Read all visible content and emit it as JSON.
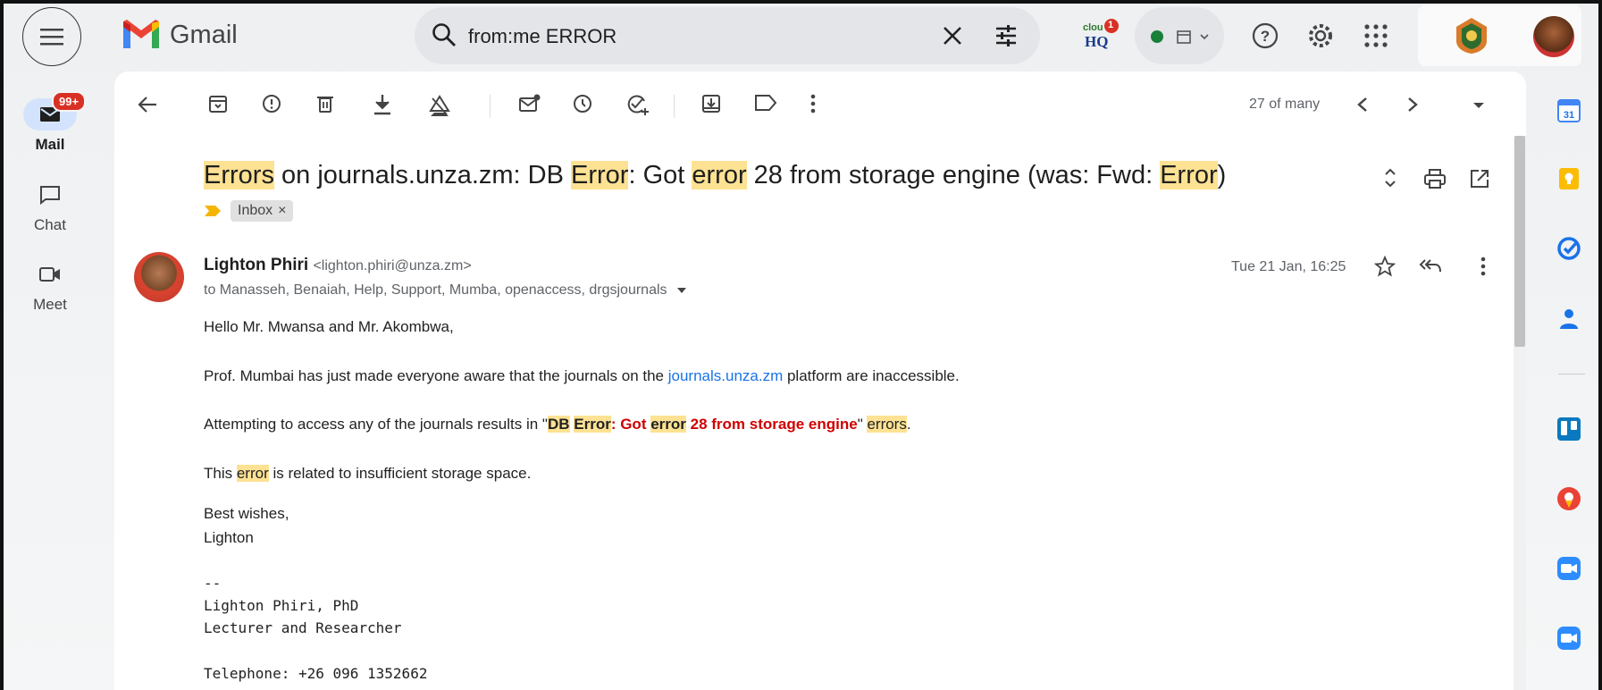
{
  "app": {
    "name": "Gmail"
  },
  "search": {
    "query": "from:me ERROR"
  },
  "topbar": {
    "clouhq_badge": "1"
  },
  "nav": {
    "mail_label": "Mail",
    "mail_badge": "99+",
    "chat_label": "Chat",
    "meet_label": "Meet"
  },
  "toolbar": {
    "pager": "27 of many"
  },
  "email": {
    "subject_parts": [
      "Errors",
      " on journals.unza.zm: DB ",
      "Error",
      ": Got ",
      "error",
      " 28 from storage engine (was: Fwd: ",
      "Error",
      ")"
    ],
    "labels": [
      "Inbox"
    ],
    "sender_name": "Lighton Phiri",
    "sender_email": "<lighton.phiri@unza.zm>",
    "recipients": "to Manasseh, Benaiah, Help, Support, Mumba, openaccess, drgsjournals",
    "date": "Tue 21 Jan, 16:25",
    "greeting": "Hello Mr. Mwansa and Mr. Akombwa,",
    "para1_before": "Prof. Mumbai has just made everyone aware that the journals on the ",
    "para1_link": "journals.unza.zm",
    "para1_after": " platform are inaccessible.",
    "para2_before": "Attempting to access any of the journals results in \"",
    "para2_db": "DB",
    "para2_error": "Error",
    "para2_got": ": Got ",
    "para2_error2": "error",
    "para2_rest": " 28 from storage engine",
    "para2_close": "\" ",
    "para2_errors": "errors",
    "para2_end": ".",
    "para3_before": "This ",
    "para3_error": "error",
    "para3_after": " is related to insufficient storage space.",
    "signoff": "Best wishes,",
    "signname": "Lighton",
    "sig_dash": "--",
    "sig_name": "Lighton Phiri, PhD",
    "sig_title": "Lecturer and Researcher",
    "sig_phone": "Telephone: +26 096 1352662"
  },
  "colors": {
    "highlight": "#fde293",
    "link": "#1a73e8",
    "error_red": "#d00000",
    "badge_red": "#d93025",
    "status_green": "#188038"
  }
}
